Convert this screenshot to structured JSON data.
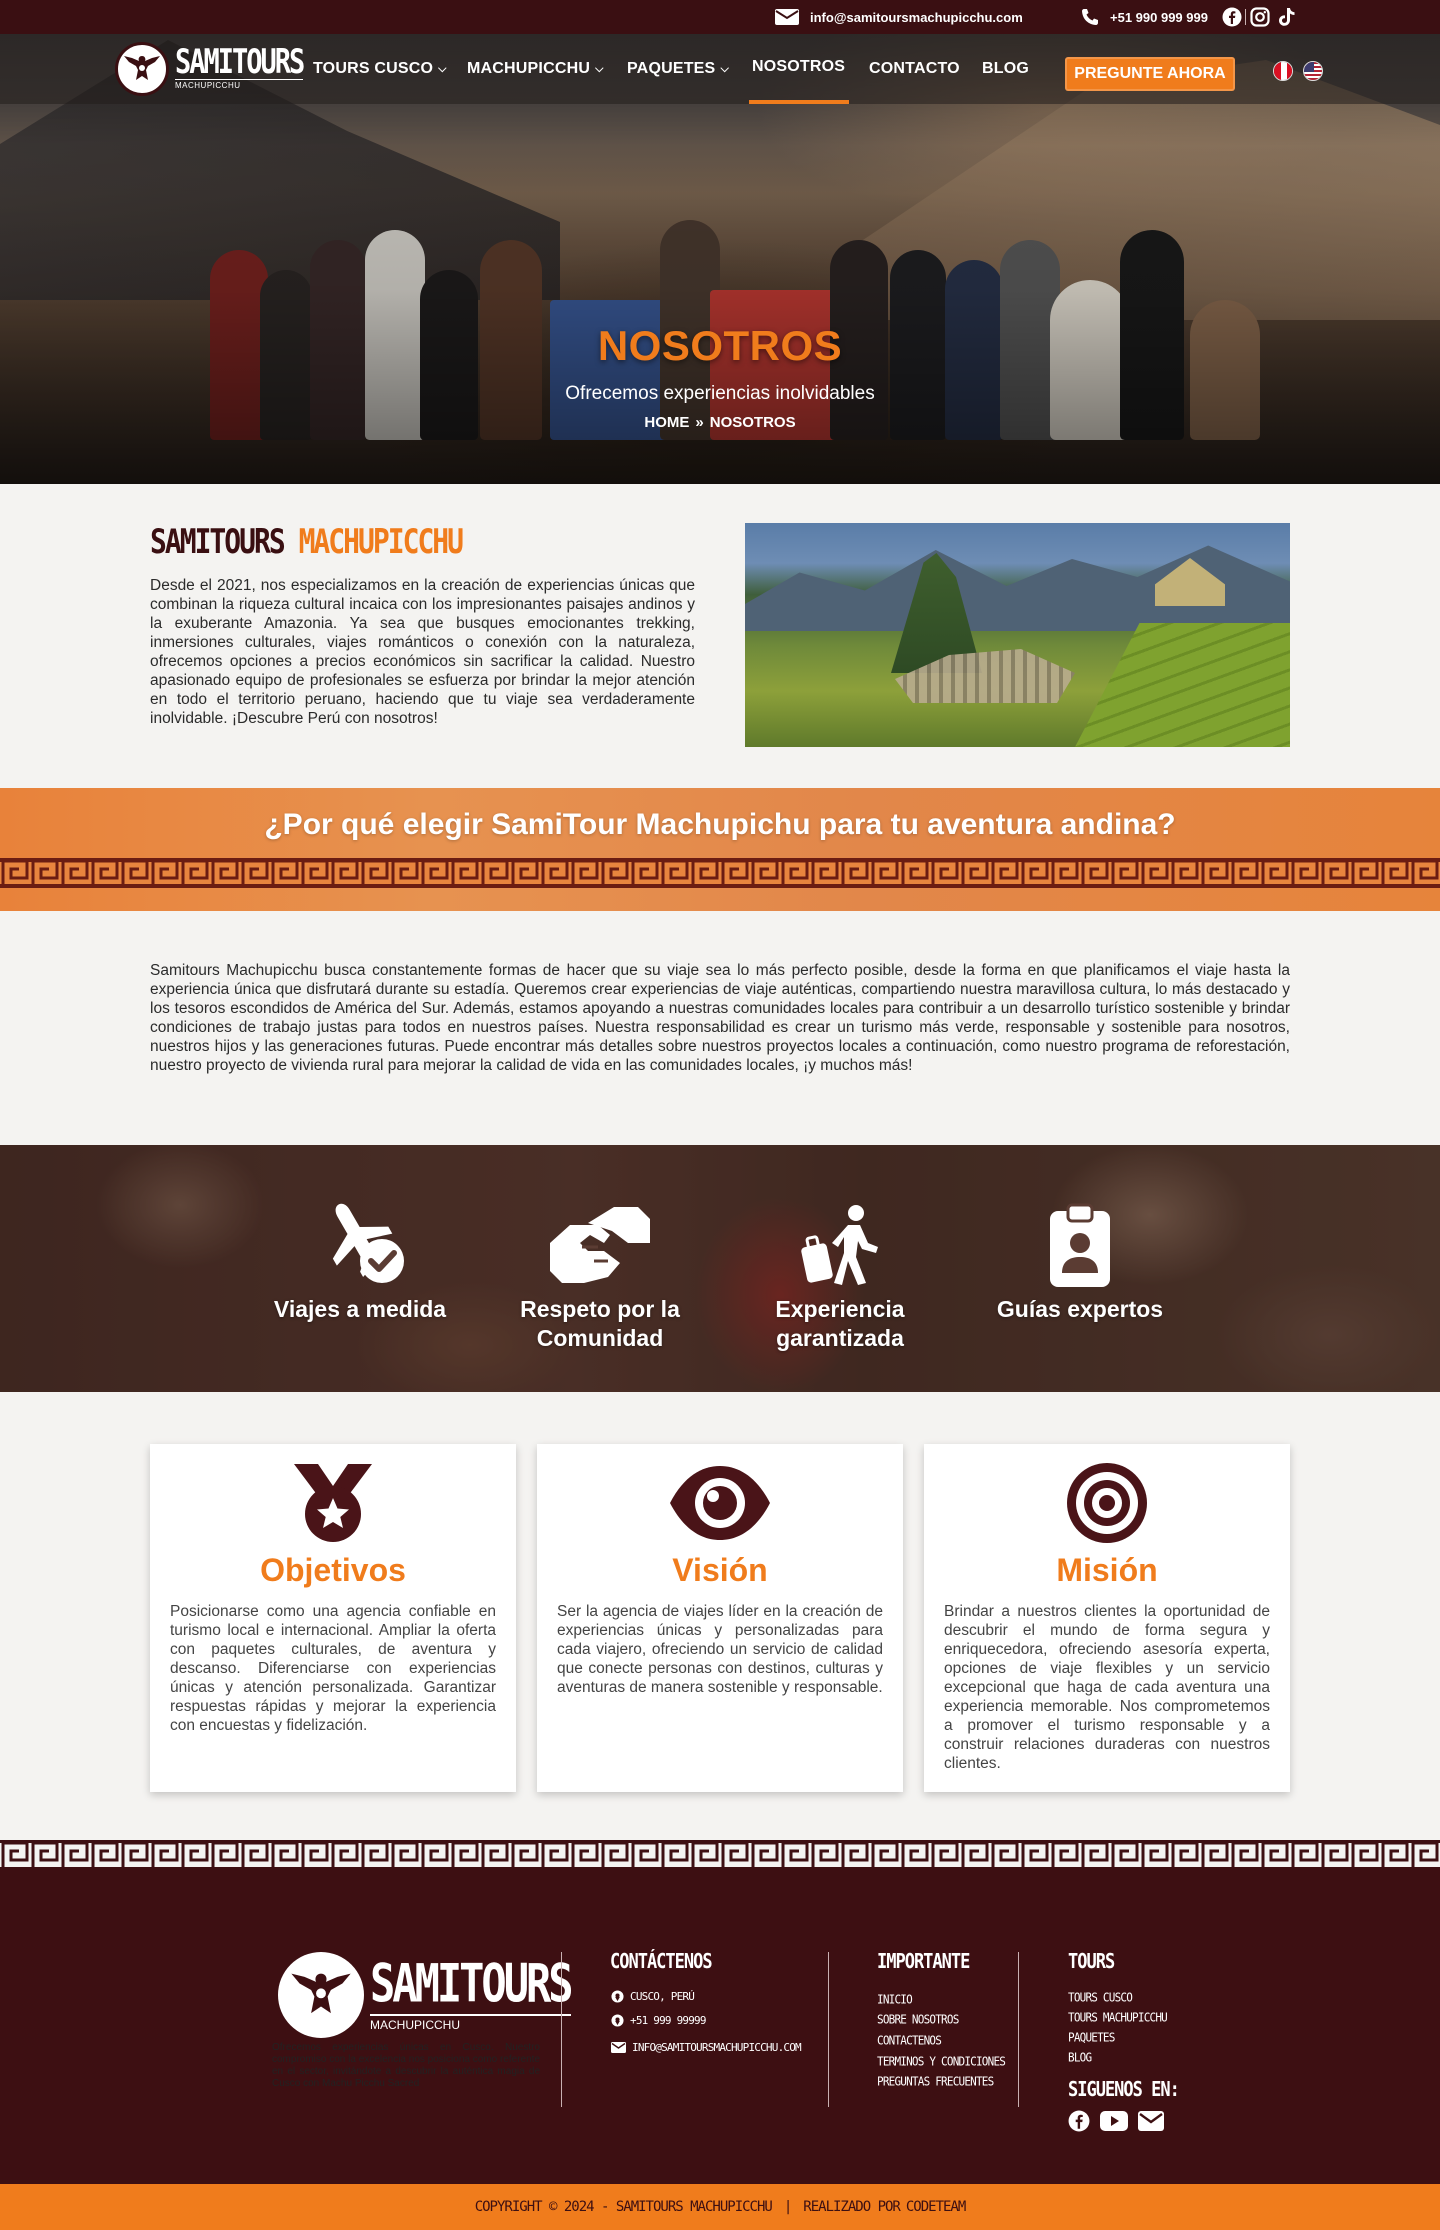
{
  "topbar": {
    "email": "info@samitoursmachupicchu.com",
    "phone": "+51 990 999 999",
    "social_icons": [
      "facebook-icon",
      "instagram-icon",
      "tiktok-icon"
    ]
  },
  "brand": {
    "name": "SAMITOURS",
    "tagline": "MACHUPICCHU"
  },
  "nav": {
    "items": [
      {
        "label": "TOURS CUSCO",
        "dropdown": true
      },
      {
        "label": "MACHUPICCHU",
        "dropdown": true
      },
      {
        "label": "PAQUETES",
        "dropdown": true
      },
      {
        "label": "NOSOTROS",
        "active": true
      },
      {
        "label": "CONTACTO"
      },
      {
        "label": "BLOG"
      }
    ],
    "cta": "PREGUNTE AHORA",
    "languages": [
      "es-peru-flag",
      "en-us-flag"
    ]
  },
  "hero": {
    "title": "NOSOTROS",
    "subtitle": "Ofrecemos experiencias inolvidables",
    "breadcrumb_home": "HOME",
    "breadcrumb_sep": "»",
    "breadcrumb_current": "NOSOTROS"
  },
  "about": {
    "heading_part1": "SAMITOURS",
    "heading_part2": "MACHUPICCHU",
    "text": "Desde el 2021, nos especializamos en la creación de experiencias únicas que combinan la riqueza cultural incaica con los impresionantes paisajes andinos y la exuberante Amazonia. Ya sea que busques emocionantes trekking, inmersiones culturales, viajes románticos o conexión con la naturaleza, ofrecemos opciones a precios económicos sin sacrificar la calidad. Nuestro apasionado equipo de profesionales se esfuerza por brindar la mejor atención en todo el territorio peruano, haciendo que tu viaje sea verdaderamente inolvidable. ¡Descubre Perú con nosotros!"
  },
  "why": {
    "title": "¿Por qué elegir SamiTour Machupichu para tu aventura andina?",
    "text": "Samitours Machupicchu busca constantemente formas de hacer que su viaje sea lo más perfecto posible, desde la forma en que planificamos el viaje hasta la experiencia única que disfrutará durante su estadía. Queremos crear experiencias de viaje auténticas, compartiendo nuestra maravillosa cultura, lo más destacado y los tesoros escondidos de América del Sur. Además, estamos apoyando a nuestras comunidades locales para contribuir a un desarrollo turístico sostenible y brindar condiciones de trabajo justas para todos en nuestros países. Nuestra responsabilidad es crear un turismo más verde, responsable y sostenible para nosotros, nuestros hijos y las generaciones futuras. Puede encontrar más detalles sobre nuestros proyectos locales a continuación, como nuestro programa de reforestación, nuestro proyecto de vivienda rural para mejorar la calidad de vida en las comunidades locales, ¡y muchos más!"
  },
  "features": [
    {
      "label": "Viajes a medida",
      "icon": "plane-check-icon"
    },
    {
      "label": "Respeto por la Comunidad",
      "icon": "handshake-icon"
    },
    {
      "label": "Experiencia garantizada",
      "icon": "hiker-luggage-icon"
    },
    {
      "label": "Guías expertos",
      "icon": "id-badge-icon"
    }
  ],
  "cards": [
    {
      "title": "Objetivos",
      "icon": "medal-icon",
      "text": "Posicionarse como una agencia confiable en turismo local e internacional. Ampliar la oferta con paquetes culturales, de aventura y descanso. Diferenciarse con experiencias únicas y atención personalizada. Garantizar respuestas rápidas y mejorar la experiencia con encuestas y fidelización."
    },
    {
      "title": "Visión",
      "icon": "eye-icon",
      "text": "Ser la agencia de viajes líder en la creación de experiencias únicas y personalizadas para cada viajero, ofreciendo un servicio de calidad que conecte personas con destinos, culturas y aventuras de manera sostenible y responsable."
    },
    {
      "title": "Misión",
      "icon": "target-icon",
      "text": "Brindar a nuestros clientes la oportunidad de descubrir el mundo de forma segura y enriquecedora, ofreciendo asesoría experta, opciones de viaje flexibles y un servicio excepcional que haga de cada aventura una experiencia memorable. Nos comprometemos a promover el turismo responsable y a construir relaciones duraderas con nuestros clientes."
    }
  ],
  "footer": {
    "description": "Ofrecemos experiencias únicas en Cusco. Nuestro compromiso con la excelencia nos posiciona como referente en el sector, invitándote a descubrir la auténtica magia de Cusco con Machu Picchu Sacred",
    "contact_title": "CONTÁCTENOS",
    "contact_location": "CUSCO, PERÚ",
    "contact_phone": "+51 999 99999",
    "contact_email": "INFO@SAMITOURSMACHUPICCHU.COM",
    "important_title": "IMPORTANTE",
    "important_links": [
      "INICIO",
      "SOBRE NOSOTROS",
      "CONTACTENOS",
      "TERMINOS Y CONDICIONES",
      "PREGUNTAS FRECUENTES"
    ],
    "tours_title": "TOURS",
    "tours_links": [
      "TOURS CUSCO",
      "TOURS MACHUPICCHU",
      "PAQUETES",
      "BLOG"
    ],
    "follow_title": "SIGUENOS EN:",
    "follow_icons": [
      "facebook-icon",
      "youtube-icon",
      "email-icon"
    ]
  },
  "copyright": {
    "text": "COPYRIGHT © 2024 - SAMITOURS MACHUPICCHU",
    "separator": "|",
    "made_by": "REALIZADO POR",
    "made_by_brand": "CODETEAM"
  },
  "colors": {
    "accent": "#f07c1c",
    "brand_dark": "#3a0f12",
    "card_icon": "#4a1418"
  }
}
